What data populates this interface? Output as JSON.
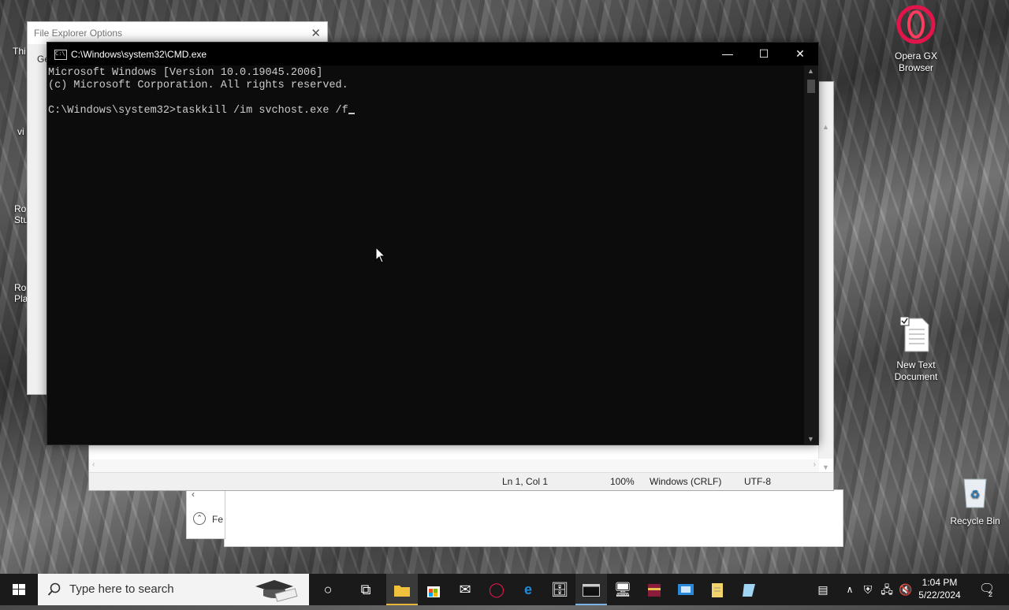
{
  "desktop": {
    "icons": [
      {
        "name": "Opera GX Browser",
        "line1": "Opera GX",
        "line2": "Browser"
      },
      {
        "name": "New Text Document",
        "line1": "New Text",
        "line2": "Document"
      },
      {
        "name": "Recycle Bin",
        "line1": "Recycle Bin",
        "line2": ""
      }
    ],
    "partial_left": [
      "Thi",
      "vi",
      "Ro",
      "Stu",
      "Ro",
      "Pla"
    ]
  },
  "file_explorer_options": {
    "title": "File Explorer Options",
    "tab": "Ge"
  },
  "notepad": {
    "status": {
      "position": "Ln 1, Col 1",
      "zoom": "100%",
      "line_ending": "Windows (CRLF)",
      "encoding": "UTF-8"
    }
  },
  "bg_panel": {
    "label": "Fe"
  },
  "cmd": {
    "title": "C:\\Windows\\system32\\CMD.exe",
    "icon_text": "C:\\",
    "lines": [
      "Microsoft Windows [Version 10.0.19045.2006]",
      "(c) Microsoft Corporation. All rights reserved.",
      "",
      "C:\\Windows\\system32>taskkill /im svchost.exe /f"
    ],
    "minimize": "—",
    "maximize": "☐",
    "close": "✕"
  },
  "taskbar": {
    "search_placeholder": "Type here to search",
    "time": "1:04 PM",
    "date": "5/22/2024",
    "notifications": "2"
  }
}
